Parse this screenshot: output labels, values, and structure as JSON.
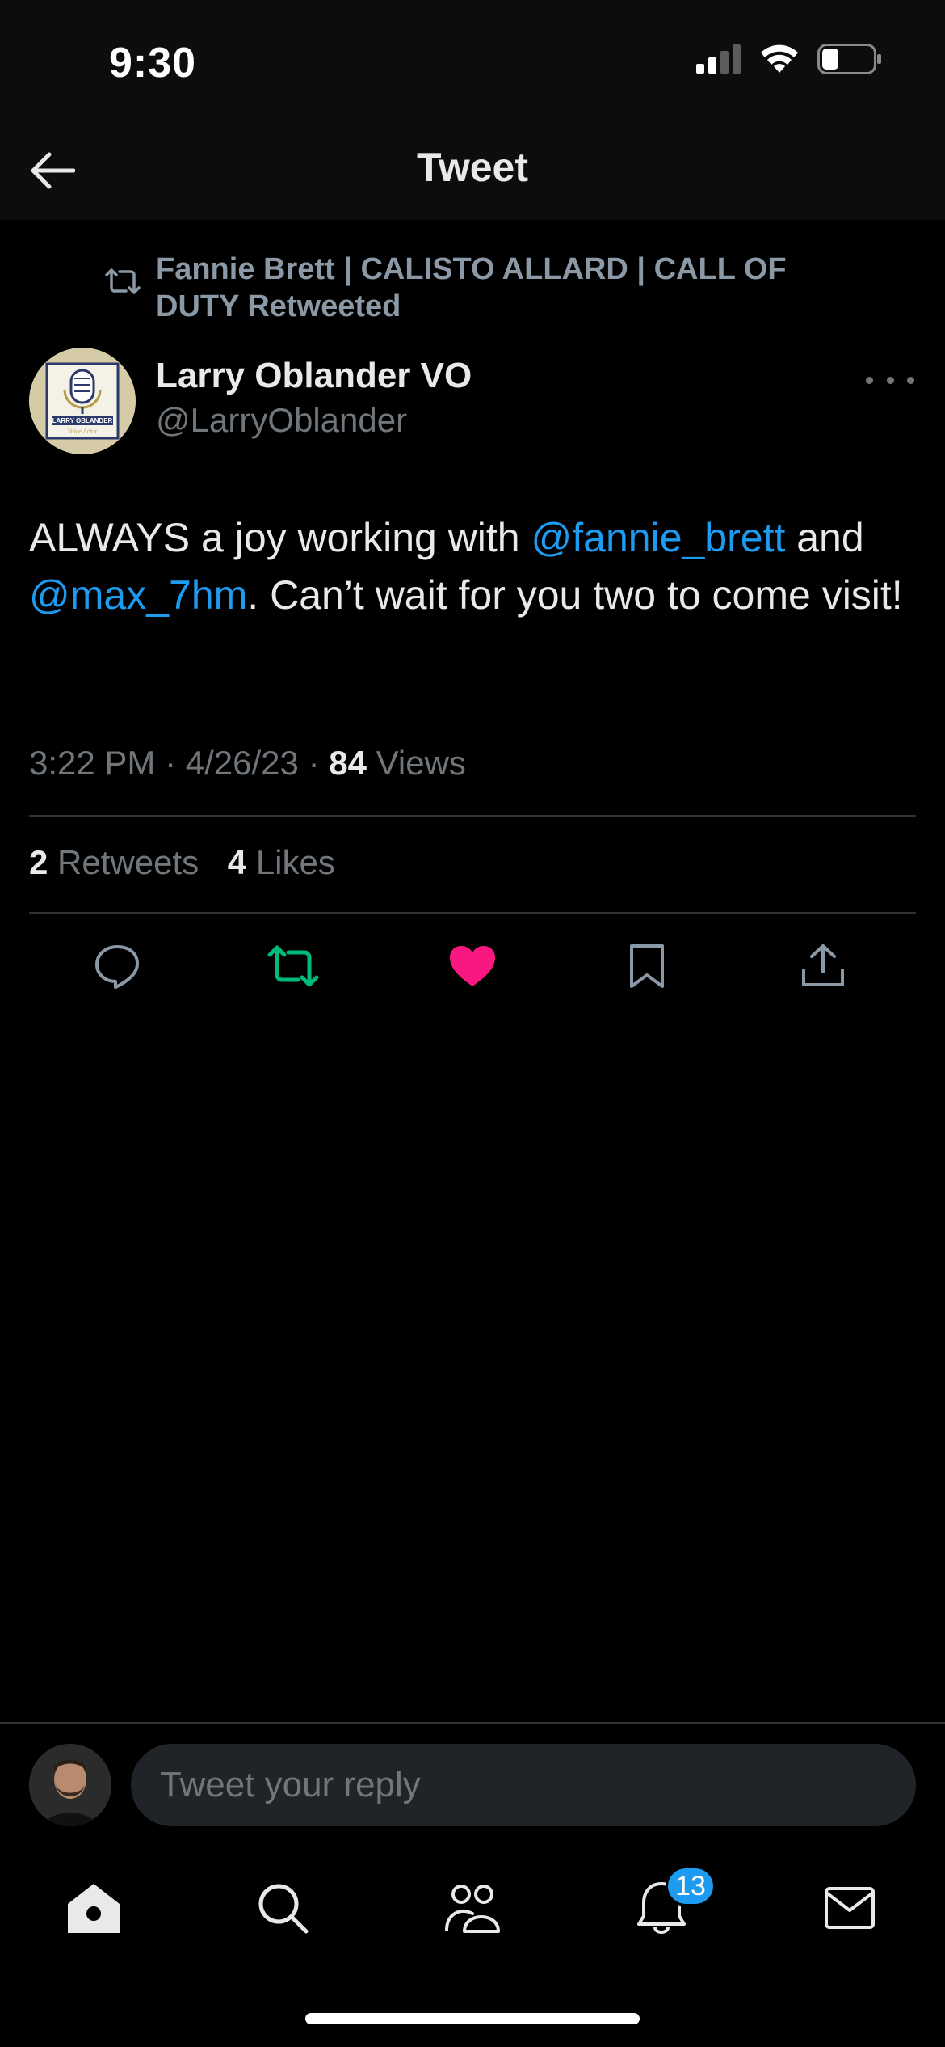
{
  "status_bar": {
    "time": "9:30"
  },
  "header": {
    "title": "Tweet"
  },
  "retweet_context": {
    "text": "Fannie Brett | CALISTO ALLARD | CALL OF DUTY Retweeted"
  },
  "author": {
    "name": "Larry Oblander VO",
    "handle": "@LarryOblander",
    "avatar_text_1": "LARRY OBLANDER",
    "avatar_text_2": "Voice Actor"
  },
  "tweet": {
    "text_part_1": "ALWAYS a joy working with ",
    "mention_1": "@fannie_brett",
    "text_part_2": " and ",
    "mention_2": "@max_7hm",
    "text_part_3": ". Can’t wait for you two to come visit!",
    "time": "3:22 PM",
    "date": "4/26/23",
    "views_count": "84",
    "views_label": "Views",
    "separator": "·"
  },
  "stats": {
    "retweets_count": "2",
    "retweets_label": "Retweets",
    "likes_count": "4",
    "likes_label": "Likes"
  },
  "actions": {
    "reply_icon": "reply-icon",
    "retweet_icon": "retweet-icon",
    "like_icon": "heart-icon",
    "bookmark_icon": "bookmark-icon",
    "share_icon": "share-icon"
  },
  "reply_bar": {
    "placeholder": "Tweet your reply"
  },
  "bottom_nav": {
    "items": [
      "home-icon",
      "search-icon",
      "communities-icon",
      "notifications-icon",
      "messages-icon"
    ],
    "notifications_badge": "13"
  },
  "colors": {
    "accent": "#1d9bf0",
    "retweet_green": "#00ba7c",
    "like_pink": "#f91880",
    "muted": "#71767b"
  }
}
